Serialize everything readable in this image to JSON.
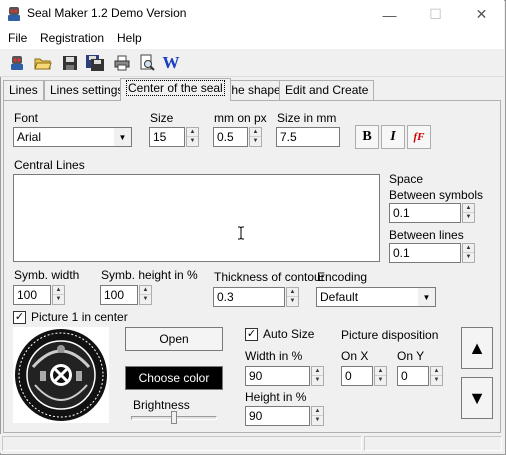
{
  "window": {
    "title": "Seal Maker 1.2 Demo Version",
    "minimize_glyph": "—",
    "maximize_glyph": "☐",
    "close_glyph": "✕"
  },
  "menu": [
    "File",
    "Registration",
    "Help"
  ],
  "toolbar": {
    "icons": [
      "app-logo-icon",
      "new-document-icon",
      "open-folder-icon",
      "save-icon",
      "save-as-icon",
      "print-icon",
      "print-preview-icon",
      "word-export-icon"
    ],
    "word_label": "W"
  },
  "tabs": [
    "Lines",
    "Lines settings",
    "Center of the seal",
    "The shape",
    "Edit and Create"
  ],
  "active_tab": "Center of the seal",
  "font_section": {
    "font_label": "Font",
    "font_value": "Arial",
    "size_label": "Size",
    "size_value": "15",
    "mm_label": "mm on px",
    "mm_value": "0.5",
    "size_mm_label": "Size in mm",
    "size_mm_value": "7.5",
    "bold_glyph": "B",
    "italic_glyph": "I",
    "font_glyph": "fF"
  },
  "central_lines": {
    "label": "Central Lines",
    "value": ""
  },
  "space": {
    "label": "Space",
    "between_symbols_label": "Between symbols",
    "between_symbols_value": "0.1",
    "between_lines_label": "Between lines",
    "between_lines_value": "0.1"
  },
  "symbol": {
    "width_label": "Symb. width",
    "width_value": "100",
    "height_label": "Symb. height in %",
    "height_value": "100"
  },
  "contour": {
    "label": "Thickness of contour",
    "value": "0.3"
  },
  "encoding": {
    "label": "Encoding",
    "value": "Default"
  },
  "picture": {
    "center_label": "Picture 1 in center",
    "center_checked": true,
    "open_label": "Open",
    "choose_color_label": "Choose color",
    "brightness_label": "Brightness",
    "brightness_level": 0.5,
    "auto_size_label": "Auto Size",
    "auto_size_checked": true,
    "width_label": "Width in %",
    "width_value": "90",
    "height_label": "Height in %",
    "height_value": "90",
    "disposition_label": "Picture disposition",
    "onx_label": "On X",
    "onx_value": "0",
    "ony_label": "On Y",
    "ony_value": "0"
  },
  "check_glyph": "✓",
  "up_arrow": "▲",
  "down_arrow": "▼",
  "combo_arrow": "▼",
  "spin_up": "▲",
  "spin_down": "▼"
}
